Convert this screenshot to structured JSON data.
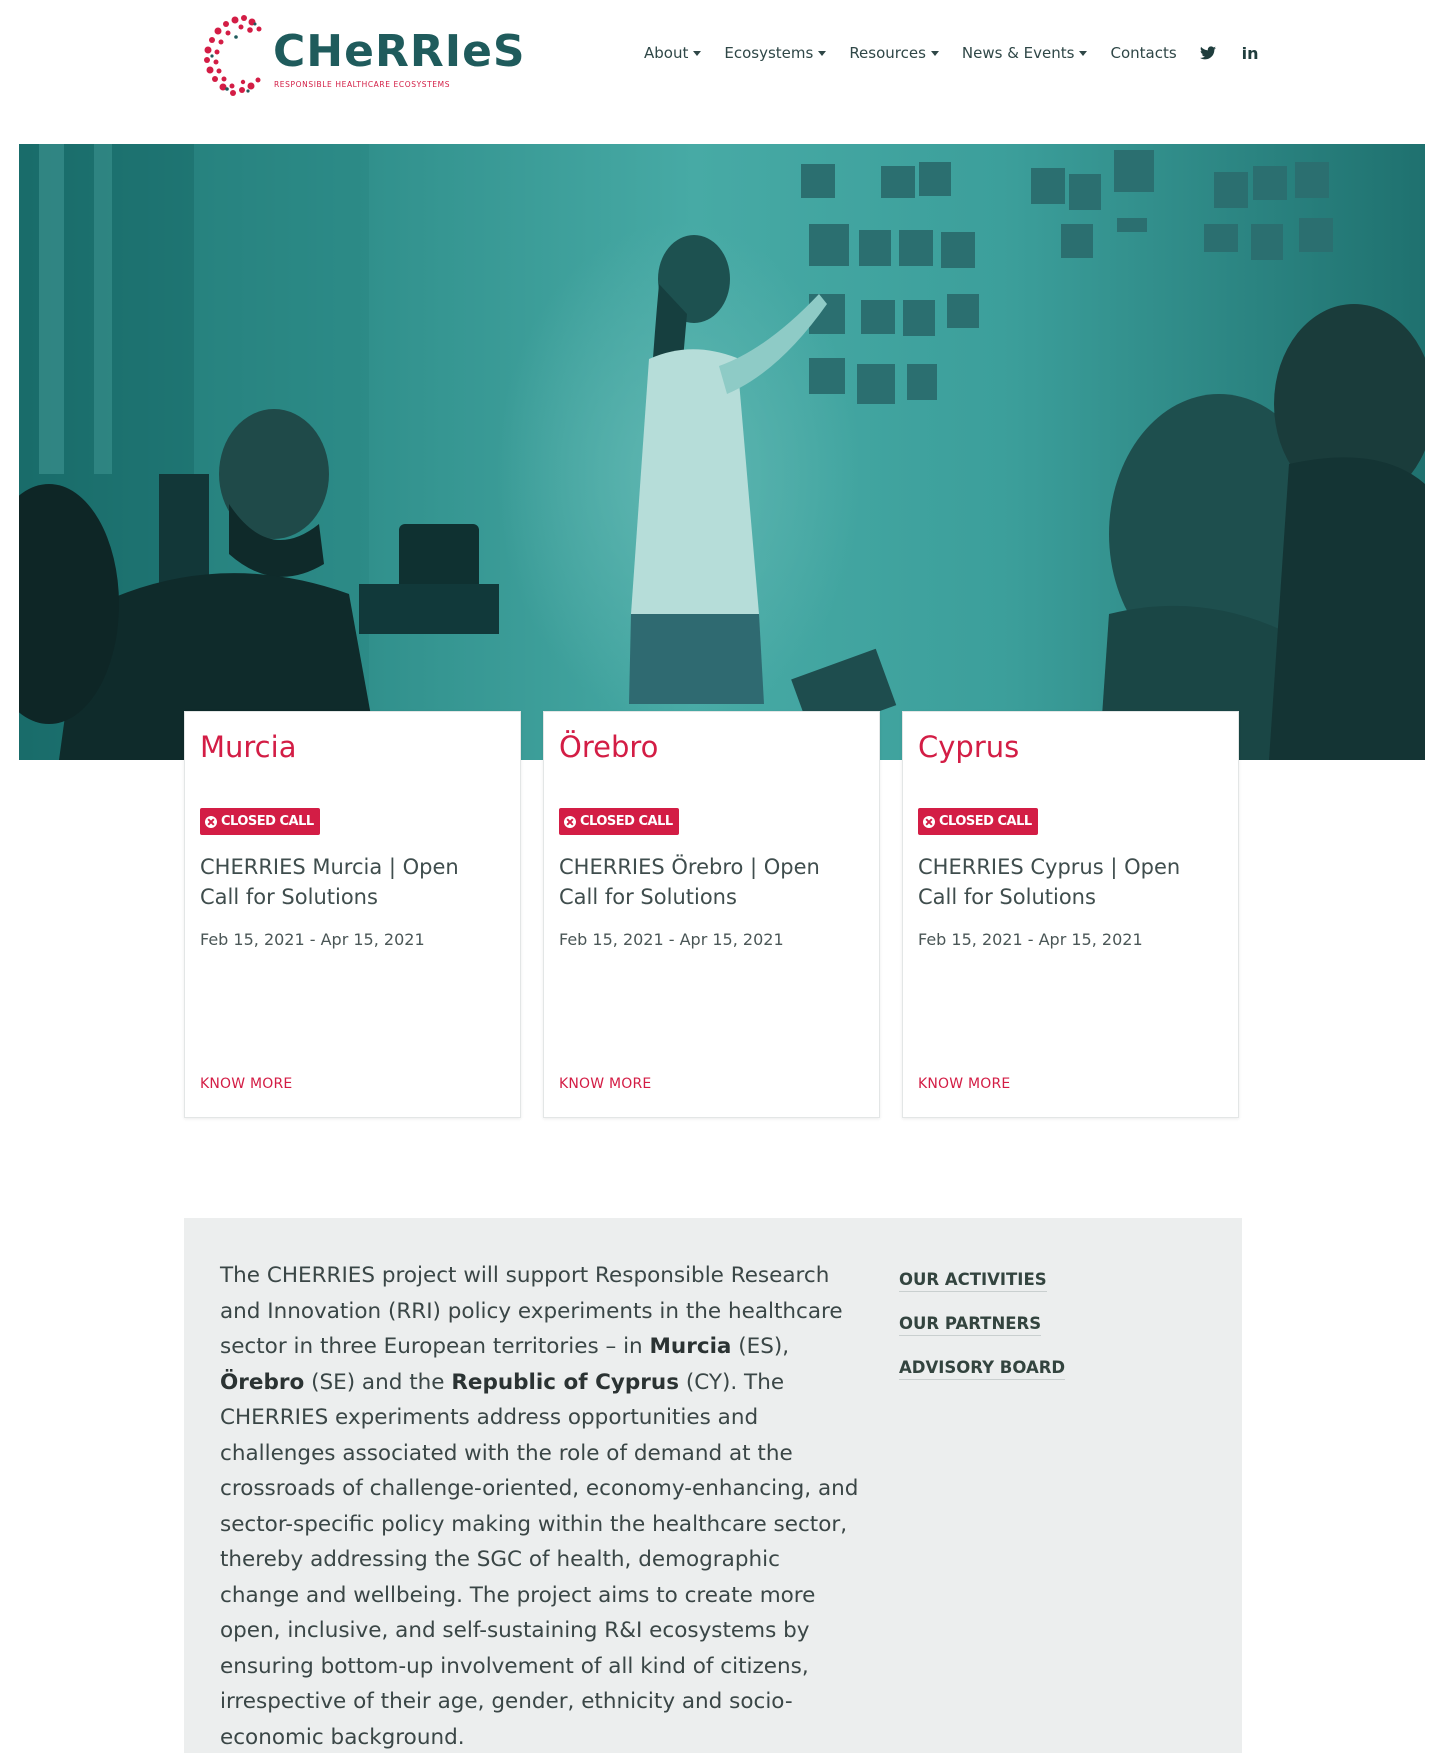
{
  "header": {
    "logo": {
      "wordmark": "CHeRRIeS",
      "tagline": "RESPONSIBLE HEALTHCARE ECOSYSTEMS"
    },
    "nav": {
      "about": "About",
      "ecosystems": "Ecosystems",
      "resources": "Resources",
      "news_events": "News & Events",
      "contacts": "Contacts",
      "twitter": "twitter-icon",
      "linkedin": "in"
    }
  },
  "cards": [
    {
      "title": "Murcia",
      "badge": "CLOSED CALL",
      "description": "CHERRIES Murcia | Open Call for Solutions",
      "dates": "Feb 15, 2021 - Apr 15, 2021",
      "link": "KNOW MORE"
    },
    {
      "title": "Örebro",
      "badge": "CLOSED CALL",
      "description": "CHERRIES Örebro | Open Call for Solutions",
      "dates": "Feb 15, 2021 - Apr 15, 2021",
      "link": "KNOW MORE"
    },
    {
      "title": "Cyprus",
      "badge": "CLOSED CALL",
      "description": "CHERRIES Cyprus | Open Call for Solutions",
      "dates": "Feb 15, 2021 - Apr 15, 2021",
      "link": "KNOW MORE"
    }
  ],
  "about": {
    "text_1": "The CHERRIES project will support Responsible Research and Innovation (RRI) policy experiments in the healthcare sector in three European territories – in ",
    "bold_1": "Murcia",
    "text_2": " (ES), ",
    "bold_2": "Örebro",
    "text_3": " (SE) and the ",
    "bold_3": "Republic of Cyprus",
    "text_4": " (CY). The CHERRIES experiments address opportunities and challenges associated with the role of demand at the crossroads of challenge-oriented, economy-enhancing, and sector-specific policy making within the healthcare sector, thereby addressing the SGC of health, demographic change and wellbeing. The project aims to create more open, inclusive, and self-sustaining R&I ecosystems by ensuring bottom-up involvement of all kind of citizens, irrespective of their age, gender, ethnicity and socio-economic background.",
    "links": [
      "OUR ACTIVITIES",
      "OUR PARTNERS",
      "ADVISORY BOARD"
    ]
  },
  "colors": {
    "brand_teal": "#1f5b5c",
    "brand_red": "#d31d45",
    "hero_tint": "#3fa3a0",
    "about_bg": "#eceeee"
  }
}
